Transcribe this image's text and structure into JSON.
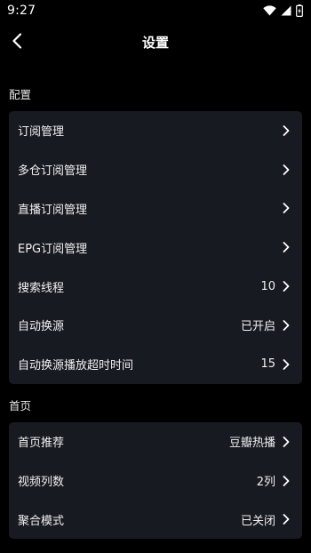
{
  "status_bar": {
    "time": "9:27"
  },
  "header": {
    "title": "设置"
  },
  "sections": {
    "config": {
      "title": "配置",
      "items": [
        {
          "label": "订阅管理",
          "value": ""
        },
        {
          "label": "多仓订阅管理",
          "value": ""
        },
        {
          "label": "直播订阅管理",
          "value": ""
        },
        {
          "label": "EPG订阅管理",
          "value": ""
        },
        {
          "label": "搜索线程",
          "value": "10"
        },
        {
          "label": "自动换源",
          "value": "已开启"
        },
        {
          "label": "自动换源播放超时时间",
          "value": "15"
        }
      ]
    },
    "home": {
      "title": "首页",
      "items": [
        {
          "label": "首页推荐",
          "value": "豆瓣热播"
        },
        {
          "label": "视频列数",
          "value": "2列"
        },
        {
          "label": "聚合模式",
          "value": "已关闭"
        }
      ]
    }
  },
  "icons": {
    "back": "chevron-left-icon",
    "row_arrow": "chevron-right-icon",
    "wifi": "wifi-icon",
    "signal": "signal-icon",
    "battery": "battery-charging-icon"
  },
  "colors": {
    "background": "#000000",
    "card": "#181a21",
    "text": "#ffffff"
  }
}
